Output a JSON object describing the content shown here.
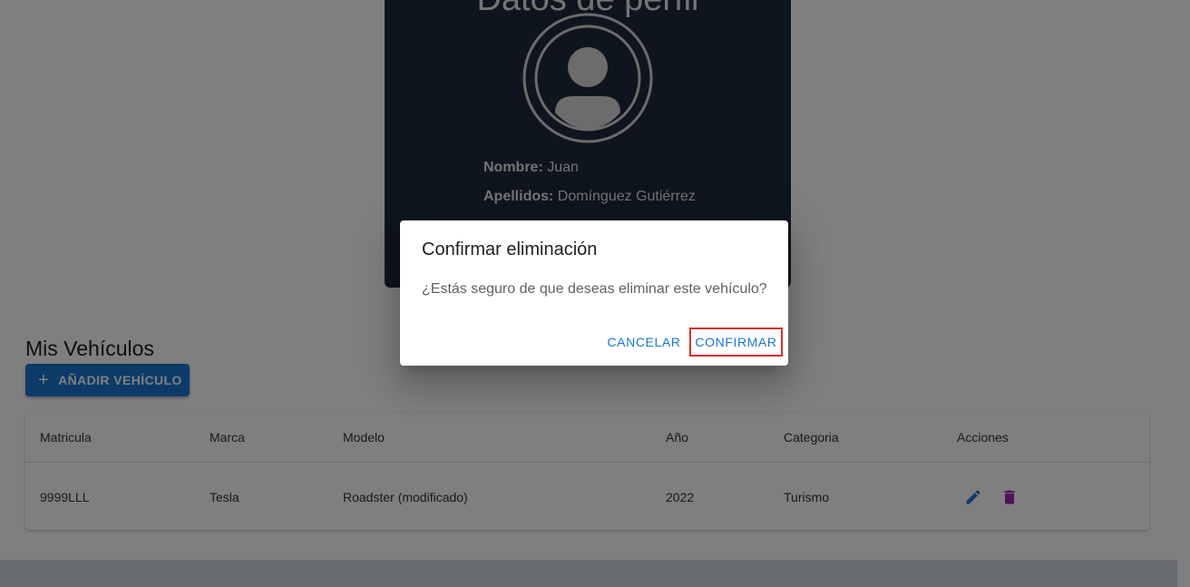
{
  "profile": {
    "title": "Datos de perfil",
    "name_label": "Nombre:",
    "name_value": "Juan",
    "surname_label": "Apellidos:",
    "surname_value": "Domínguez Gutiérrez",
    "avatar_icon": "account-circle-icon"
  },
  "vehicles": {
    "section_title": "Mis Vehículos",
    "add_button_label": "AÑADIR VEHÍCULO",
    "add_icon": "plus-icon",
    "columns": [
      "Matricula",
      "Marca",
      "Modelo",
      "Año",
      "Categoria",
      "Acciones"
    ],
    "rows": [
      {
        "plate": "9999LLL",
        "brand": "Tesla",
        "model": "Roadster (modificado)",
        "year": "2022",
        "category": "Turismo"
      }
    ],
    "edit_icon": "pencil-icon",
    "delete_icon": "trash-icon"
  },
  "dialog": {
    "title": "Confirmar eliminación",
    "message": "¿Estás seguro de que deseas eliminar este vehículo?",
    "cancel_label": "CANCELAR",
    "confirm_label": "CONFIRMAR"
  },
  "colors": {
    "primary": "#1976d2",
    "card_bg": "#1f2a3c",
    "delete": "#9c27b0",
    "highlight": "#d32f2f"
  }
}
